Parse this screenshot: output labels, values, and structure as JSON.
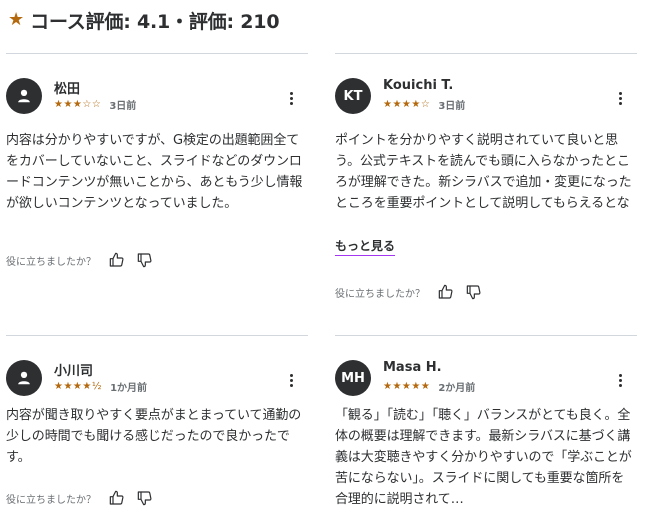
{
  "header": {
    "title": "コース評価: 4.1・評価: 210"
  },
  "helpful_label": "役に立ちましたか？",
  "reviews": [
    {
      "name": "松田",
      "avatar_initials": "",
      "stars": "★★★☆☆",
      "rating": 3,
      "date": "3日前",
      "body": "内容は分かりやすいですが、G検定の出題範囲全てをカバーしていないこと、スライドなどのダウンロードコンテンツが無いことから、あともう少し情報が欲しいコンテンツとなっていました。",
      "more": ""
    },
    {
      "name": "Kouichi T.",
      "avatar_initials": "KT",
      "stars": "★★★★☆",
      "rating": 4,
      "date": "3日前",
      "body": "ポイントを分かりやすく説明されていて良いと思う。公式テキストを読んでも頭に入らなかったところが理解できた。新シラバスで追加・変更になったところを重要ポイントとして説明してもらえるとなお良いと思った。シ…",
      "more": "もっと見る"
    },
    {
      "name": "小川司",
      "avatar_initials": "",
      "stars": "★★★★½",
      "rating": 4.5,
      "date": "1か月前",
      "body": "内容が聞き取りやすく要点がまとまっていて通勤の少しの時間でも聞ける感じだったので良かったです。",
      "more": ""
    },
    {
      "name": "Masa H.",
      "avatar_initials": "MH",
      "stars": "★★★★★",
      "rating": 5,
      "date": "2か月前",
      "body": "「観る」「読む」「聴く」バランスがとても良く。全体の概要は理解できます。最新シラバスに基づく講義は大変聴きやすく分かりやすいので「学ぶことが苦にならない」。スライドに関しても重要な箇所を合理的に説明されて…",
      "more": ""
    }
  ],
  "colors": {
    "star": "#b4690e",
    "text": "#2d2f31",
    "muted": "#6a6f73",
    "divider": "#d1d7dc",
    "link_underline": "#a435f0"
  }
}
